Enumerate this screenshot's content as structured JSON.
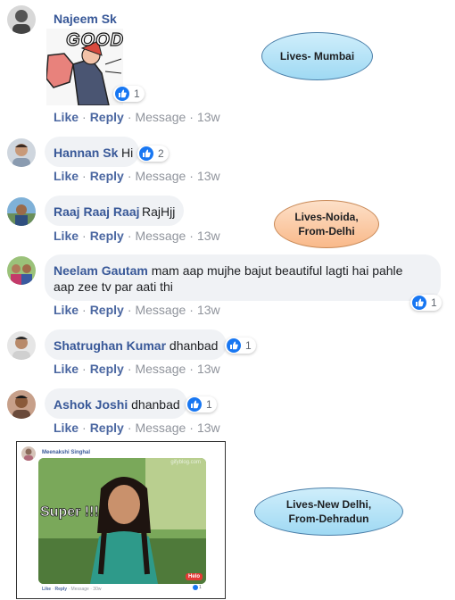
{
  "comments": [
    {
      "author": "Najeem Sk",
      "text": "",
      "sticker_text": "GOOD",
      "reactions": "1",
      "like": "Like",
      "reply": "Reply",
      "message": "Message",
      "time": "13w"
    },
    {
      "author": "Hannan Sk",
      "text": "Hi",
      "reactions": "2",
      "like": "Like",
      "reply": "Reply",
      "message": "Message",
      "time": "13w"
    },
    {
      "author": "Raaj Raaj Raaj",
      "text": "RajHjj",
      "like": "Like",
      "reply": "Reply",
      "message": "Message",
      "time": "13w"
    },
    {
      "author": "Neelam Gautam",
      "text": "mam aap mujhe bajut beautiful lagti hai pahle",
      "text2": "aap zee tv par aati thi",
      "reactions": "1",
      "like": "Like",
      "reply": "Reply",
      "message": "Message",
      "time": "13w"
    },
    {
      "author": "Shatrughan Kumar",
      "text": "dhanbad",
      "reactions": "1",
      "like": "Like",
      "reply": "Reply",
      "message": "Message",
      "time": "13w"
    },
    {
      "author": "Ashok Joshi",
      "text": "dhanbad",
      "reactions": "1",
      "like": "Like",
      "reply": "Reply",
      "message": "Message",
      "time": "13w"
    }
  ],
  "embedded": {
    "author": "Meenakshi Singhal",
    "watermark": "gifyblog.com",
    "overlay_text": "Super !!!",
    "badge": "Helo",
    "like": "Like",
    "reply": "Reply",
    "message": "Message",
    "time": "30w",
    "reactions": "1"
  },
  "callouts": [
    {
      "line1": "Lives- Mumbai",
      "line2": "",
      "color": "blue"
    },
    {
      "line1": "Lives-Noida,",
      "line2": "From-Delhi",
      "color": "orange"
    },
    {
      "line1": "Lives-New Delhi,",
      "line2": "From-Dehradun",
      "color": "blue"
    }
  ],
  "colors": {
    "author": "#385898",
    "like_blue": "#1877f2",
    "bubble": "#f0f2f5",
    "meta": "#90949c"
  },
  "icons": [
    "like-icon",
    "avatar"
  ]
}
